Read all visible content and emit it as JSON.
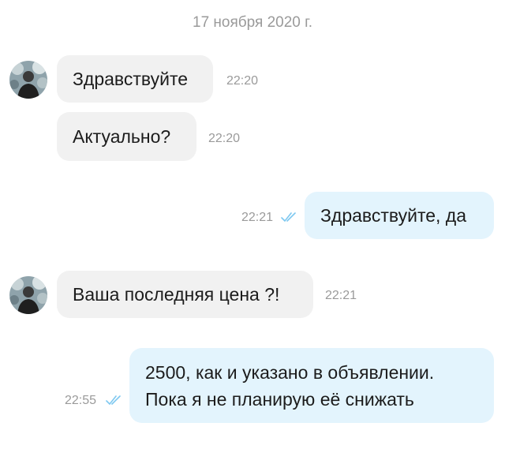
{
  "chat": {
    "date": "17 ноября 2020 г.",
    "colors": {
      "incoming_bubble": "#f1f1f1",
      "outgoing_bubble": "#e3f4fd",
      "read_ticks": "#7ec8f0",
      "timestamp": "#9a9a9a"
    },
    "messages": [
      {
        "direction": "incoming",
        "text": "Здравствуйте",
        "time": "22:20",
        "show_avatar": true
      },
      {
        "direction": "incoming",
        "text": "Актуально?",
        "time": "22:20",
        "show_avatar": false
      },
      {
        "direction": "outgoing",
        "text": "Здравствуйте, да",
        "time": "22:21",
        "status_icon": "double-check-icon"
      },
      {
        "direction": "incoming",
        "text": "Ваша последняя цена ?!",
        "time": "22:21",
        "show_avatar": true
      },
      {
        "direction": "outgoing",
        "lines": [
          "2500, как и указано в объявлении.",
          "Пока я не планирую её снижать"
        ],
        "time": "22:55",
        "status_icon": "double-check-icon"
      }
    ]
  }
}
